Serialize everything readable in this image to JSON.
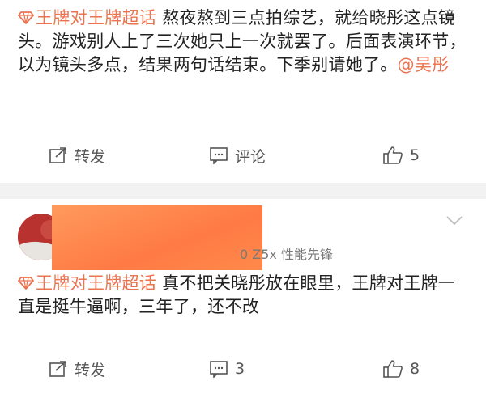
{
  "post1": {
    "topic": "王牌对王牌超话",
    "body": "熬夜熬到三点拍综艺，就给晓彤这点镜头。游戏别人上了三次她只上一次就罢了。后面表演环节，以为镜头多点，结果两句话结束。下季别请她了。",
    "mention": "@吴彤",
    "repost_label": "转发",
    "comment_label": "评论",
    "like_count": "5"
  },
  "post2": {
    "device": "0 Z5x 性能先锋",
    "topic": "王牌对王牌超话",
    "body": "真不把关晓彤放在眼里，王牌对王牌一直是挺牛逼啊，三年了，还不改",
    "repost_label": "转发",
    "comment_count": "3",
    "like_count": "8"
  },
  "colors": {
    "accent": "#eb7350",
    "separator": "#f2f2f2",
    "redaction": "#ff8a4a"
  },
  "icons": [
    "diamond-topic-icon",
    "repost-icon",
    "comment-icon",
    "thumbs-up-icon",
    "chevron-down-icon"
  ]
}
